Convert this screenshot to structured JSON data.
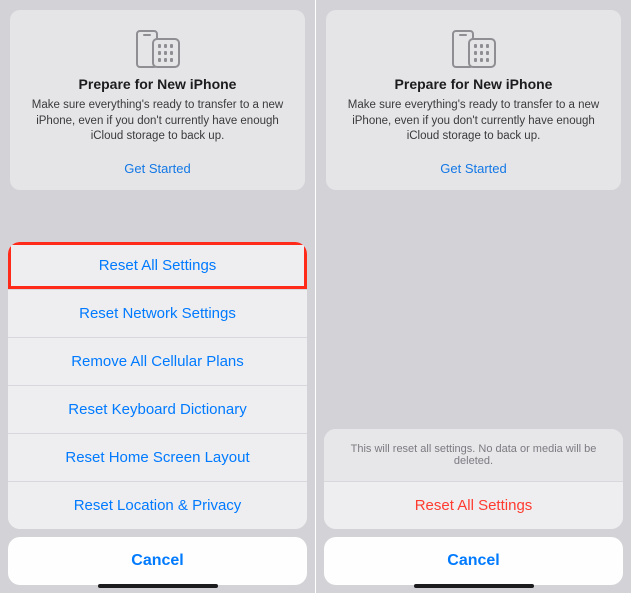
{
  "left": {
    "card": {
      "title": "Prepare for New iPhone",
      "desc": "Make sure everything's ready to transfer to a new iPhone, even if you don't currently have enough iCloud storage to back up.",
      "cta": "Get Started"
    },
    "actions": [
      "Reset All Settings",
      "Reset Network Settings",
      "Remove All Cellular Plans",
      "Reset Keyboard Dictionary",
      "Reset Home Screen Layout",
      "Reset Location & Privacy"
    ],
    "cancel": "Cancel"
  },
  "right": {
    "card": {
      "title": "Prepare for New iPhone",
      "desc": "Make sure everything's ready to transfer to a new iPhone, even if you don't currently have enough iCloud storage to back up.",
      "cta": "Get Started"
    },
    "confirm": {
      "message": "This will reset all settings. No data or media will be deleted.",
      "action": "Reset All Settings"
    },
    "cancel": "Cancel"
  }
}
